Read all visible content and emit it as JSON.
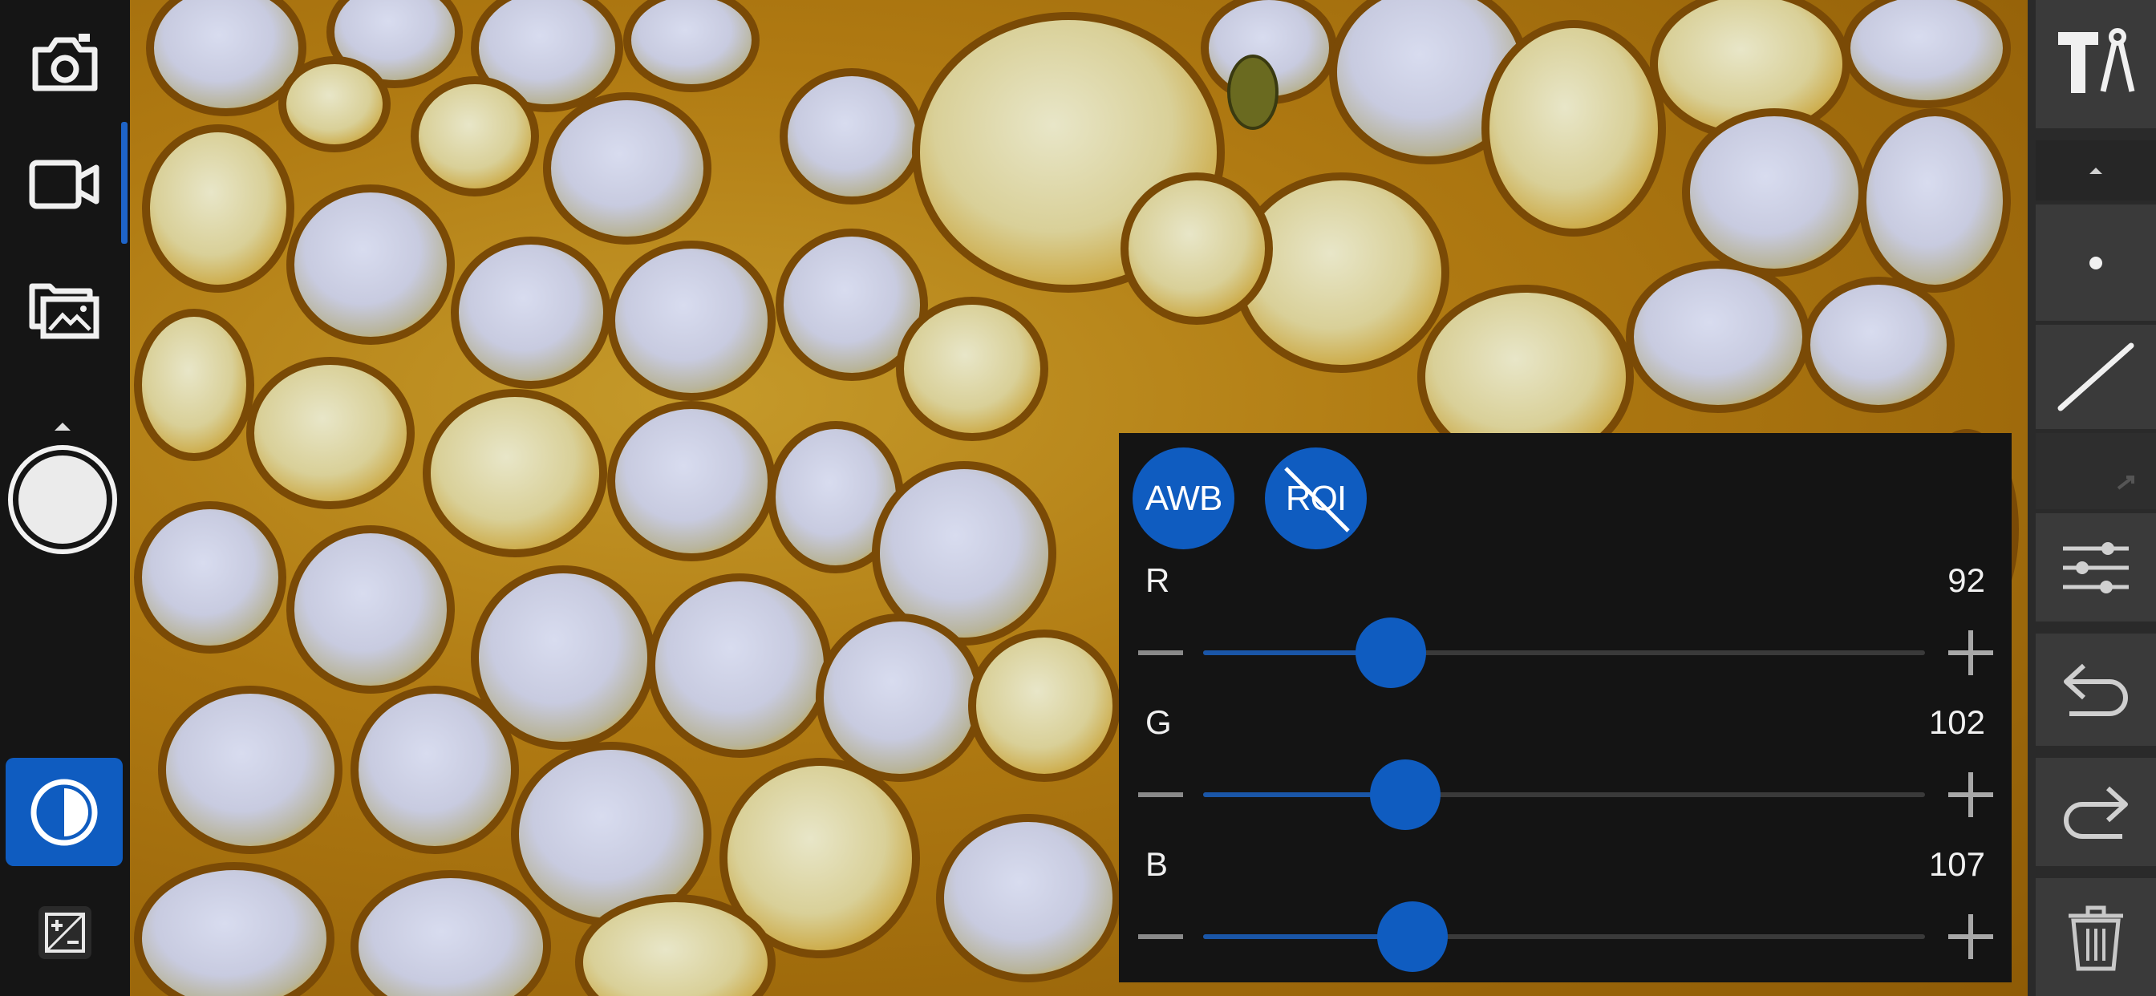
{
  "sidebar_left": {
    "items": [
      {
        "name": "photo-capture-mode",
        "icon": "camera-icon"
      },
      {
        "name": "video-record-mode",
        "icon": "video-camera-icon",
        "active": true
      },
      {
        "name": "gallery",
        "icon": "gallery-folder-icon"
      },
      {
        "name": "shutter",
        "icon": "shutter-button"
      },
      {
        "name": "white-balance",
        "icon": "contrast-circle-icon",
        "active": true
      },
      {
        "name": "exposure-compensation",
        "icon": "exposure-plus-minus-icon"
      }
    ]
  },
  "sidebar_right": {
    "items": [
      {
        "name": "measurement-tools",
        "icon": "measure-tools-icon"
      },
      {
        "name": "collapse",
        "icon": "caret-up-icon"
      },
      {
        "name": "point",
        "icon": "point-icon"
      },
      {
        "name": "line",
        "icon": "line-icon"
      },
      {
        "name": "more",
        "icon": "expand-corner-icon"
      },
      {
        "name": "settings",
        "icon": "sliders-icon"
      },
      {
        "name": "undo",
        "icon": "undo-icon"
      },
      {
        "name": "redo",
        "icon": "redo-icon"
      },
      {
        "name": "delete",
        "icon": "trash-icon"
      }
    ]
  },
  "wb_panel": {
    "awb_label": "AWB",
    "roi_label": "ROI",
    "channels": [
      {
        "label": "R",
        "value": "92",
        "fraction": 0.26
      },
      {
        "label": "G",
        "value": "102",
        "fraction": 0.28
      },
      {
        "label": "B",
        "value": "107",
        "fraction": 0.29
      }
    ]
  },
  "colors": {
    "accent": "#0f5cc0",
    "panel_bg": "#141414",
    "sidebar_bg": "#151515"
  }
}
